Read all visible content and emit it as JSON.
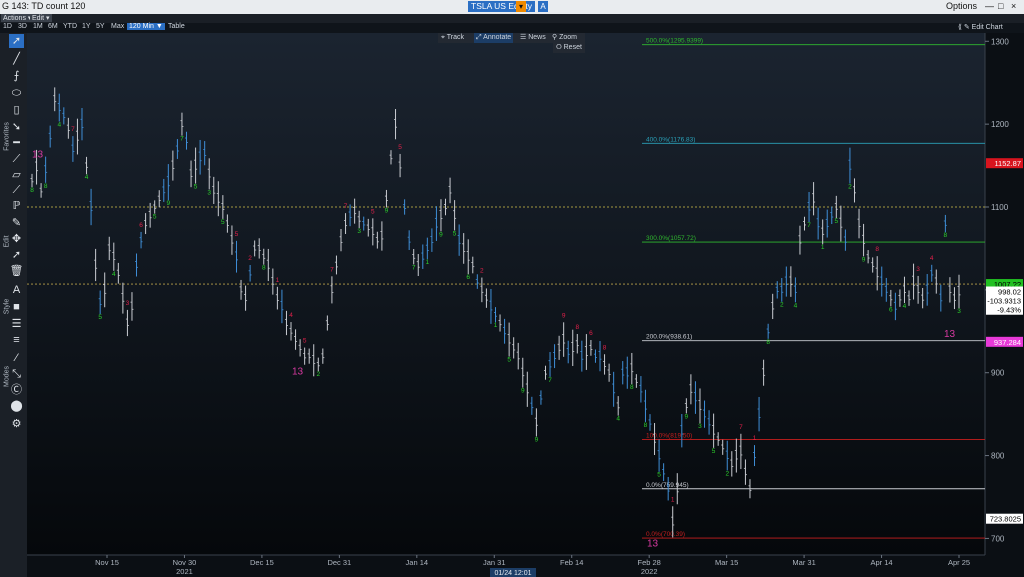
{
  "window": {
    "title": "G 143: TD count 120",
    "security": "TSLA US Equity",
    "security_letter": "A",
    "options_label": "Options",
    "minimize": "—",
    "maximize": "□",
    "close": "×"
  },
  "menubar": {
    "actions": "Actions ▾",
    "edit": "Edit ▾"
  },
  "toolbar": {
    "ranges": [
      "1D",
      "3D",
      "1M",
      "6M",
      "YTD",
      "1Y",
      "5Y",
      "Max"
    ],
    "interval": "120 Min ▼",
    "table": "Table",
    "edit_chart": "⟪ ✎ Edit Chart"
  },
  "chart_controls": {
    "track": "⌖ Track",
    "annotate": "⤢ Annotate",
    "news": "☰ News",
    "zoom": "⚲ Zoom",
    "reset": "⭘ Reset"
  },
  "sidebar": {
    "labels": {
      "favorites": "Favorites",
      "edit": "Edit",
      "style": "Style",
      "modes": "Modes"
    },
    "icons": [
      "cursor-icon",
      "line-icon",
      "text-icon",
      "ellipse-icon",
      "candle-icon",
      "arrow-icon",
      "hline-icon",
      "segment-icon",
      "channel-icon",
      "trend-icon",
      "fib-icon",
      "pen-icon",
      "move-icon",
      "select-icon",
      "trash-icon",
      "font-icon",
      "box-icon",
      "width-icon",
      "style-icon",
      "mode1-icon",
      "mode2-icon",
      "mode3-icon",
      "mode4-icon",
      "gear-icon"
    ]
  },
  "colors": {
    "background": "#0b0f14",
    "price_bars": "#c9ccd2",
    "price_bars_alt": "#3f8fd8",
    "buy_count": "#2bd12b",
    "sell_count": "#e0204a",
    "thirteen": "#d63aa0",
    "fib_green": "#2fb82f",
    "fib_teal": "#2aa0b8",
    "fib_red": "#c81e1e"
  },
  "chart_data": {
    "type": "bar",
    "symbol": "TSLA US Equity",
    "ylim": [
      680,
      1310
    ],
    "y_ticks": [
      700,
      800,
      900,
      1000,
      1100,
      1200,
      1300
    ],
    "x_ticks": [
      "Nov 15",
      "Nov 30",
      "Dec 15",
      "Dec 31",
      "Jan 14",
      "Jan 31",
      "Feb 14",
      "Feb 28",
      "Mar 15",
      "Mar 31",
      "Apr 14",
      "Apr 25"
    ],
    "x_years": [
      {
        "label": "2021",
        "at": "Nov 30"
      },
      {
        "label": "2022",
        "at": "Feb 28"
      }
    ],
    "cursor_date": "01/24 12:01",
    "fib_levels": [
      {
        "label": "500.0%(1295.9399)",
        "value": 1295.94,
        "color": "green"
      },
      {
        "label": "400.0%(1176.83)",
        "value": 1176.83,
        "color": "teal"
      },
      {
        "label": "300.0%(1057.72)",
        "value": 1057.72,
        "color": "green"
      },
      {
        "label": "200.0%(938.61)",
        "value": 938.61,
        "color": "white"
      },
      {
        "label": "100.0%(819.50)",
        "value": 819.5,
        "color": "red"
      },
      {
        "label": "0.0%(759.945)",
        "value": 759.945,
        "color": "white"
      },
      {
        "label": "0.0%(700.39)",
        "value": 700.39,
        "color": "red"
      }
    ],
    "price_labels": [
      {
        "text": "1152.87",
        "value": 1152.87,
        "bg": "#d8141e",
        "fg": "#ffffff"
      },
      {
        "text": "1007.??",
        "value": 1007,
        "bg": "#22c122",
        "fg": "#000000"
      },
      {
        "text": "998.02",
        "value": 998.02,
        "bg": "#ffffff",
        "fg": "#000000"
      },
      {
        "text": "-103.9313",
        "value": 987,
        "bg": "#ffffff",
        "fg": "#000000"
      },
      {
        "text": "-9.43%",
        "value": 976,
        "bg": "#ffffff",
        "fg": "#000000"
      },
      {
        "text": "937.284",
        "value": 937.284,
        "bg": "#e83ad8",
        "fg": "#ffffff"
      },
      {
        "text": "723.8025",
        "value": 723.8025,
        "bg": "#ffffff",
        "fg": "#000000"
      }
    ],
    "thirteen_marks": [
      "13",
      "13",
      "13",
      "13"
    ],
    "series": [
      {
        "prices": [
          1132,
          1148,
          1120,
          1145,
          1185,
          1230,
          1220,
          1210,
          1195,
          1170,
          1185,
          1200,
          1150,
          1100,
          1030,
          985,
          1000,
          1050,
          1040,
          1020,
          990,
          960,
          980,
          1030,
          1060,
          1080,
          1090,
          1100,
          1110,
          1120,
          1130,
          1150,
          1170,
          1200,
          1180,
          1140,
          1150,
          1160,
          1165,
          1140,
          1120,
          1110,
          1100,
          1080,
          1060,
          1040,
          1000,
          990,
          1020,
          1050,
          1050,
          1040,
          1030,
          1010,
          990,
          980,
          960,
          950,
          940,
          930,
          920,
          920,
          915,
          910,
          920,
          960,
          1000,
          1030,
          1060,
          1080,
          1090,
          1095,
          1085,
          1080,
          1075,
          1070,
          1060,
          1065,
          1110,
          1160,
          1200,
          1150,
          1100,
          1060,
          1040,
          1030,
          1040,
          1050,
          1060,
          1080,
          1090,
          1100,
          1120,
          1090,
          1060,
          1050,
          1040,
          1030,
          1010,
          1000,
          990,
          980,
          970,
          960,
          950,
          940,
          930,
          920,
          900,
          880,
          860,
          840,
          870,
          900,
          910,
          920,
          930,
          940,
          925,
          930,
          935,
          920,
          925,
          930,
          920,
          920,
          910,
          900,
          880,
          860,
          900,
          900,
          905,
          890,
          880,
          860,
          840,
          820,
          800,
          780,
          760,
          720,
          760,
          830,
          860,
          880,
          870,
          860,
          850,
          840,
          830,
          820,
          810,
          800,
          790,
          800,
          805,
          780,
          760,
          800,
          850,
          900,
          950,
          980,
          1000,
          1000,
          1010,
          1010,
          1000,
          1060,
          1080,
          1100,
          1110,
          1080,
          1070,
          1080,
          1090,
          1100,
          1080,
          1060,
          1150,
          1120,
          1080,
          1060,
          1040,
          1030,
          1020,
          1010,
          1000,
          990,
          980,
          990,
          1000,
          990,
          1010,
          1000,
          990,
          1000,
          1020,
          1010,
          990,
          1080,
          1000,
          990,
          998
        ]
      }
    ]
  }
}
